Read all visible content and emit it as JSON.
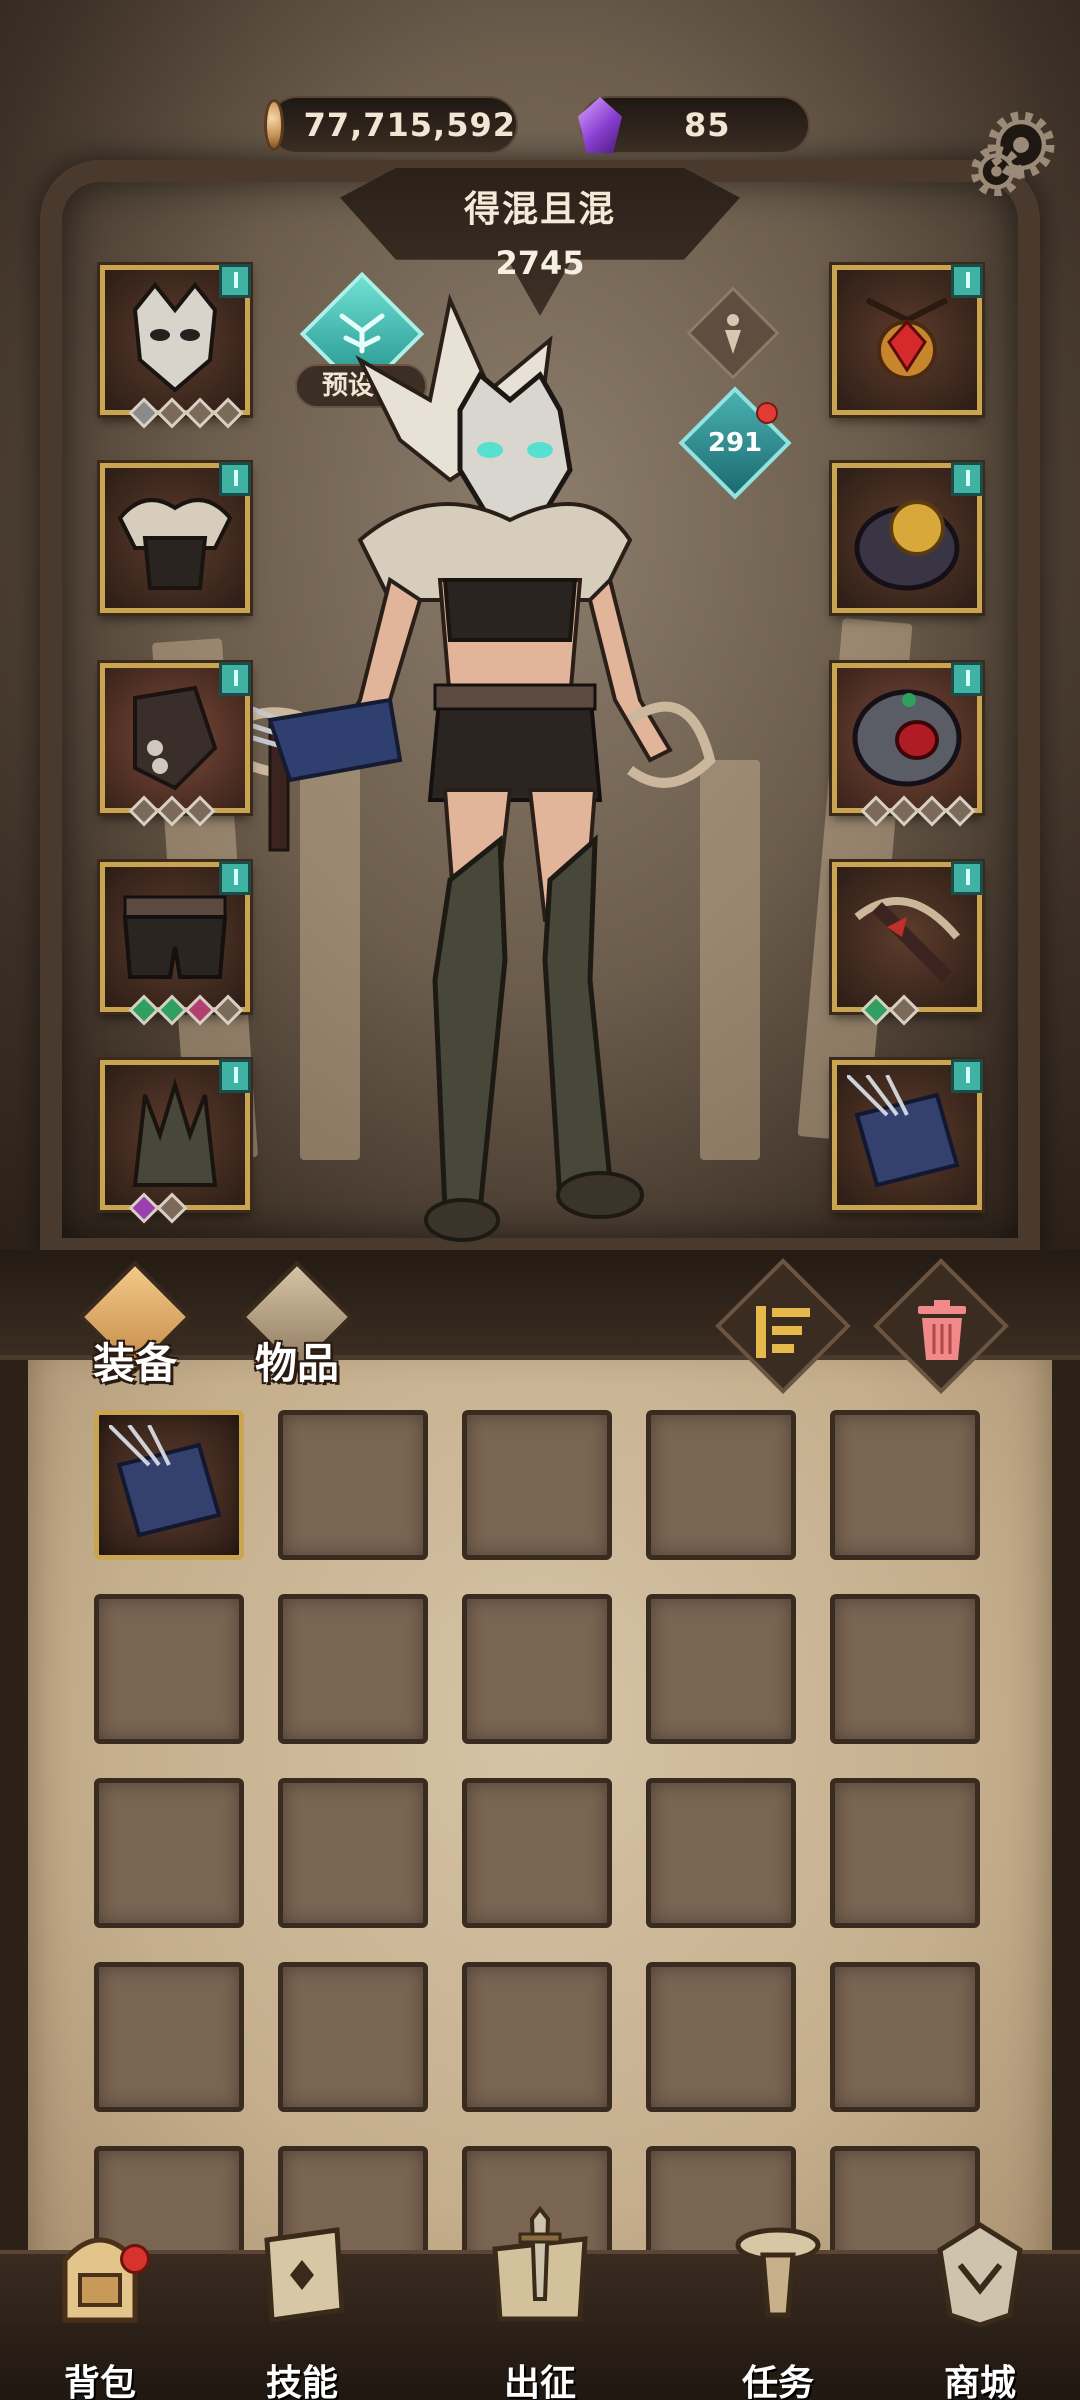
{
  "currency": {
    "gold": "77,715,592",
    "gems": "85"
  },
  "hero": {
    "name": "得混且混",
    "power": "2745",
    "preset_label": "预设一",
    "unspent_points": "291"
  },
  "equipment": {
    "left": [
      {
        "name": "wolf-skull-helmet",
        "gems": [
          "#8a8a8a",
          "#7b6a5a",
          "#7b6a5a",
          "#7b6a5a"
        ]
      },
      {
        "name": "fur-armor"
      },
      {
        "name": "gauntlet",
        "gems": [
          "#7b6a5a",
          "#7b6a5a",
          "#7b6a5a"
        ]
      },
      {
        "name": "belted-shorts",
        "gems": [
          "#2fa060",
          "#2fa060",
          "#b04070",
          "#7b6a5a"
        ]
      },
      {
        "name": "spiked-boots",
        "gems": [
          "#9a3fb0",
          "#7b6a5a"
        ]
      }
    ],
    "right": [
      {
        "name": "ruby-amulet"
      },
      {
        "name": "gold-orb-ring"
      },
      {
        "name": "eye-ring",
        "gems": [
          "#7b6a5a",
          "#7b6a5a",
          "#7b6a5a",
          "#7b6a5a"
        ]
      },
      {
        "name": "crossbow",
        "gems": [
          "#2fa060",
          "#7b6a5a"
        ]
      },
      {
        "name": "arrow-quiver"
      }
    ]
  },
  "bag": {
    "tabs": [
      {
        "label": "装备",
        "active": true
      },
      {
        "label": "物品",
        "active": false
      }
    ],
    "sort_icon": "sort-icon",
    "trash_icon": "trash-icon",
    "slot_count": 25,
    "items": [
      {
        "slot": 0,
        "name": "arrow-quiver"
      }
    ]
  },
  "nav": {
    "items": [
      {
        "label": "背包",
        "icon": "backpack-icon",
        "badge": true
      },
      {
        "label": "技能",
        "icon": "skill-book-icon",
        "badge": false
      },
      {
        "label": "出征",
        "icon": "map-sword-icon",
        "badge": false
      },
      {
        "label": "任务",
        "icon": "scroll-icon",
        "badge": false
      },
      {
        "label": "商城",
        "icon": "shop-crest-icon",
        "badge": false
      }
    ]
  },
  "colors": {
    "accent_teal": "#3fb2a4",
    "gold_frame": "#c9a552",
    "badge_red": "#e23b34",
    "parchment": "#c4ae8c"
  }
}
